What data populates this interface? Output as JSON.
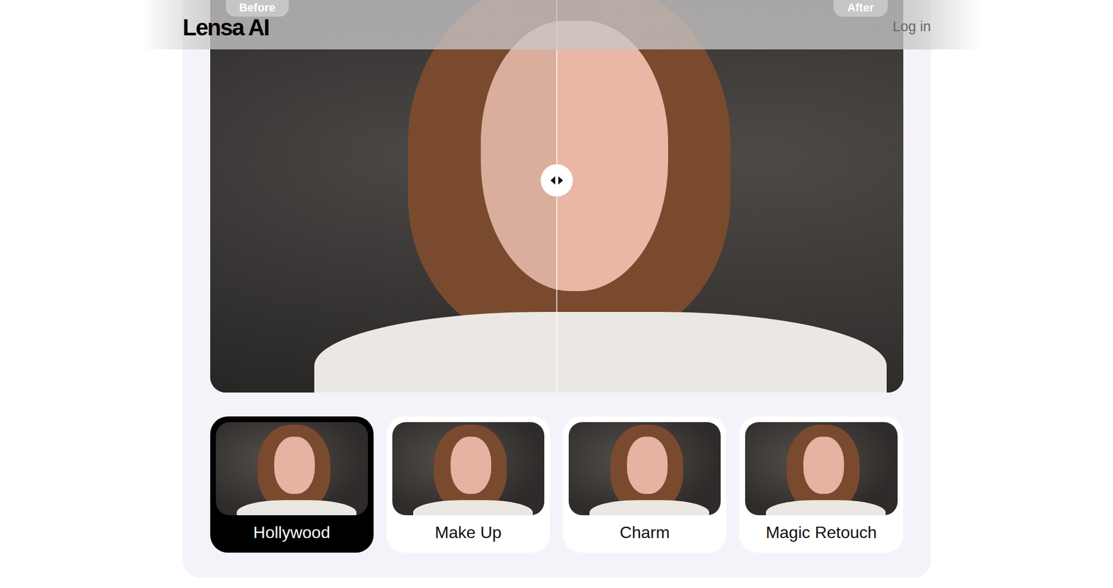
{
  "header": {
    "logo": "Lensa AI",
    "login": "Log in"
  },
  "comparison": {
    "before_label": "Before",
    "after_label": "After",
    "slider": {
      "level": 0.5
    }
  },
  "styles": [
    {
      "label": "Hollywood",
      "selected": true
    },
    {
      "label": "Make Up",
      "selected": false
    },
    {
      "label": "Charm",
      "selected": false
    },
    {
      "label": "Magic Retouch",
      "selected": false
    }
  ]
}
